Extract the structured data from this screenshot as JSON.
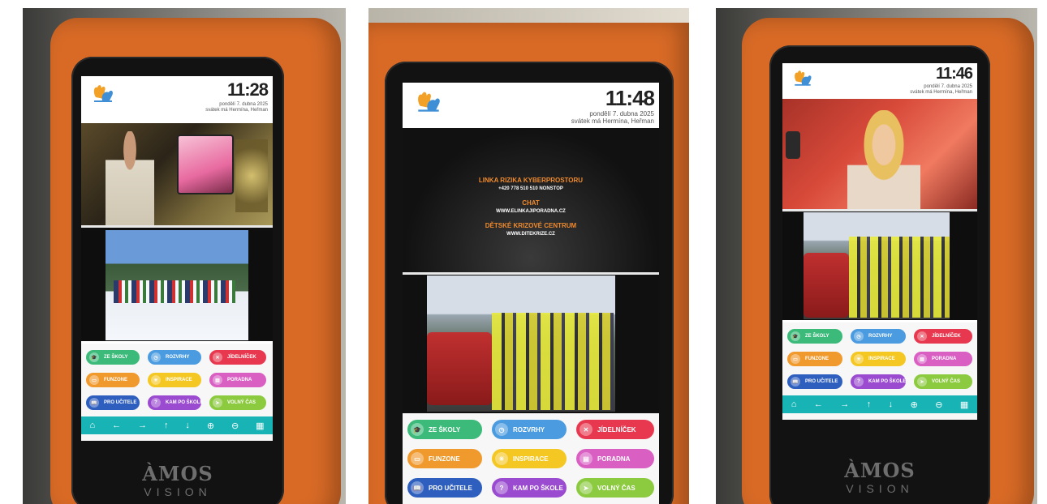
{
  "panels": [
    {
      "clock": "11:28",
      "date_line": "pondělí 7. dubna 2025",
      "nameday_line": "svátek má Hermína, Heřman"
    },
    {
      "clock": "11:48",
      "date_line": "pondělí 7. dubna 2025",
      "nameday_line": "svátek má Hermína, Heřman",
      "info": {
        "h1": "LINKA RIZIKA KYBERPROSTORU",
        "l1": "+420 778 510 510 NONSTOP",
        "h2": "CHAT",
        "l2": "WWW.ELINKAJIPORADNA.CZ",
        "h3": "DĚTSKÉ KRIZOVÉ CENTRUM",
        "l3": "WWW.DITEKRIZE.CZ"
      }
    },
    {
      "clock": "11:46",
      "date_line": "pondělí 7. dubna 2025",
      "nameday_line": "svátek má Hermína, Heřman"
    }
  ],
  "menu": [
    {
      "label": "ZE ŠKOLY",
      "color": "#3cba7a"
    },
    {
      "label": "ROZVRHY",
      "color": "#4a9be0"
    },
    {
      "label": "JÍDELNÍČEK",
      "color": "#e8384f"
    },
    {
      "label": "FUNZONE",
      "color": "#f09a2e"
    },
    {
      "label": "INSPIRACE",
      "color": "#f4c722"
    },
    {
      "label": "PORADNA",
      "color": "#d95fc3"
    },
    {
      "label": "PRO UČITELE",
      "color": "#2e5fbf"
    },
    {
      "label": "KAM PO ŠKOLE",
      "color": "#9a4bd0"
    },
    {
      "label": "VOLNÝ ČAS",
      "color": "#8cca3f"
    }
  ],
  "menu_icons": [
    "graduation-cap-icon",
    "clock-icon",
    "cutlery-icon",
    "game-controller-icon",
    "lightbulb-icon",
    "document-icon",
    "book-icon",
    "question-icon",
    "paper-plane-icon"
  ],
  "nav_icons": [
    "home-icon",
    "arrow-left-icon",
    "arrow-right-icon",
    "arrow-up-icon",
    "arrow-down-icon",
    "zoom-in-icon",
    "zoom-out-icon",
    "keyboard-icon"
  ],
  "brand": {
    "line1": "ÀMOS",
    "line2": "VISION"
  },
  "colors": {
    "frame": "#d86a26",
    "nav": "#18b3b4"
  }
}
